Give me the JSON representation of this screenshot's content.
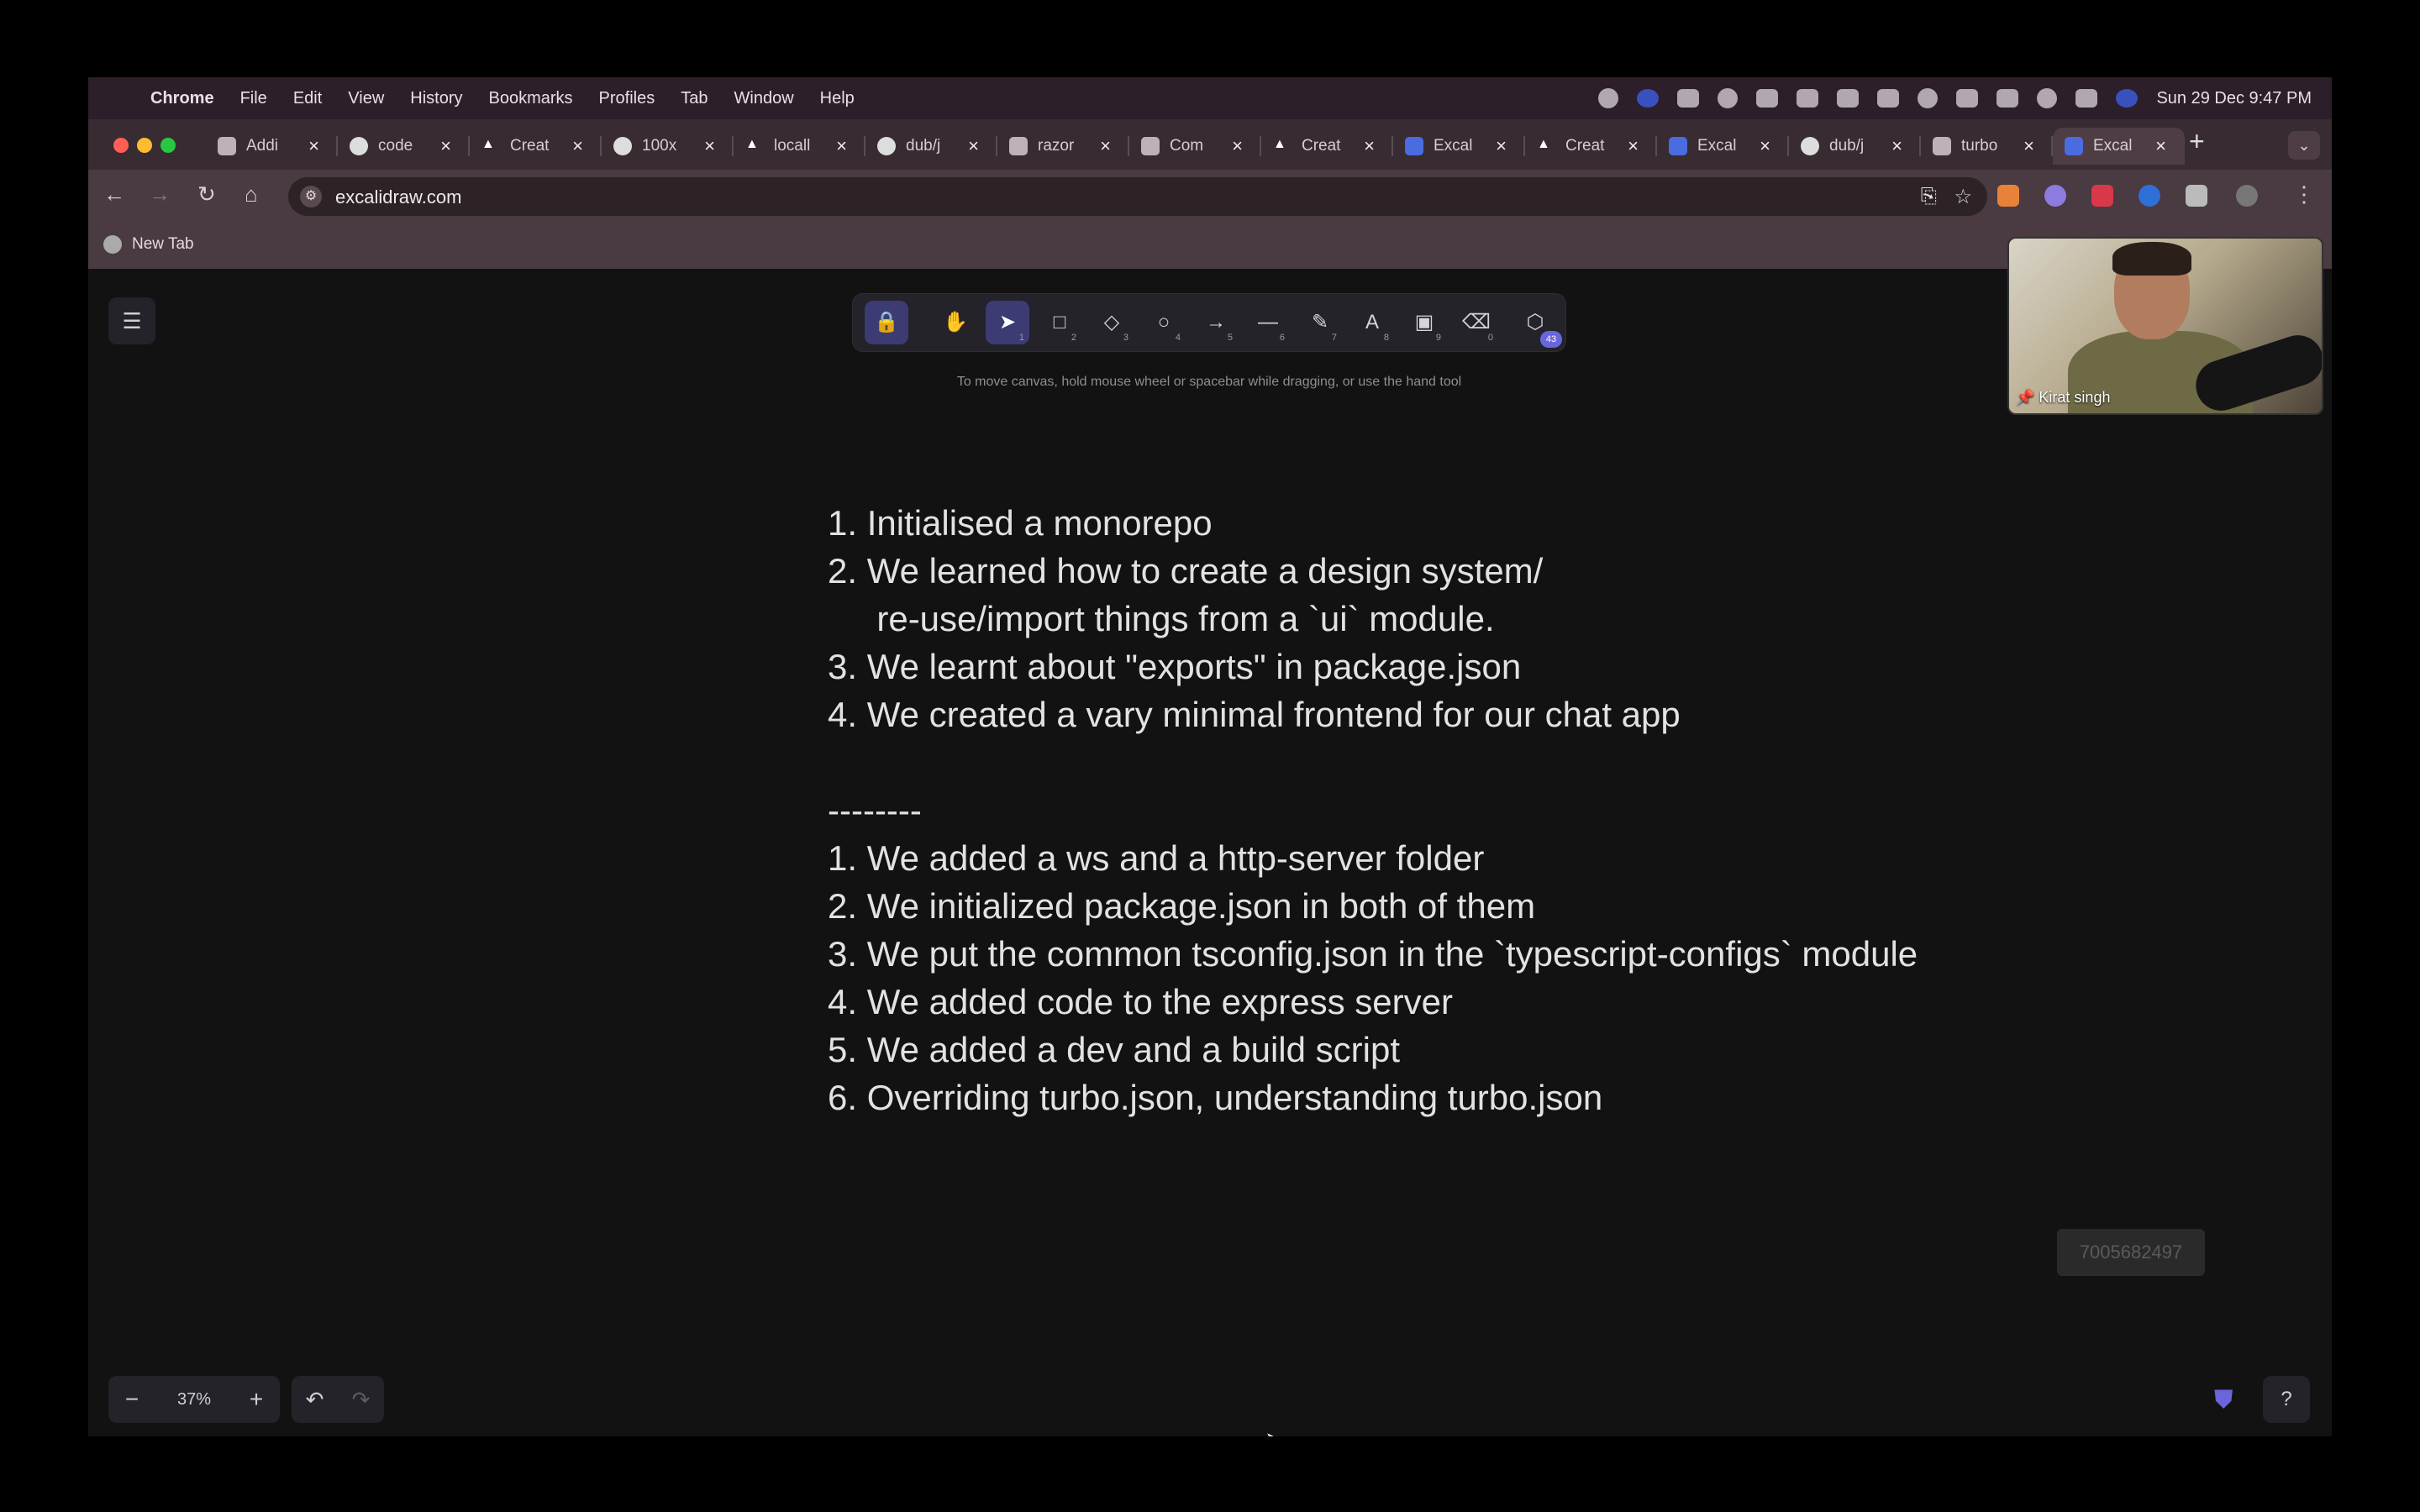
{
  "menubar": {
    "app": "Chrome",
    "items": [
      "File",
      "Edit",
      "View",
      "History",
      "Bookmarks",
      "Profiles",
      "Tab",
      "Window",
      "Help"
    ],
    "clock": "Sun 29 Dec  9:47 PM"
  },
  "tabs": [
    {
      "title": "Addi",
      "icon": "notion-icon",
      "active": false
    },
    {
      "title": "code",
      "icon": "github-icon",
      "active": false
    },
    {
      "title": "Creat",
      "icon": "vercel-icon",
      "active": false
    },
    {
      "title": "100x",
      "icon": "github-icon",
      "active": false
    },
    {
      "title": "locall",
      "icon": "vercel-icon",
      "active": false
    },
    {
      "title": "dub/j",
      "icon": "github-icon",
      "active": false
    },
    {
      "title": "razor",
      "icon": "google-icon",
      "active": false
    },
    {
      "title": "Com",
      "icon": "tab-icon",
      "active": false
    },
    {
      "title": "Creat",
      "icon": "vercel-icon",
      "active": false
    },
    {
      "title": "Excal",
      "icon": "excalidraw-icon",
      "active": false
    },
    {
      "title": "Creat",
      "icon": "vercel-icon",
      "active": false
    },
    {
      "title": "Excal",
      "icon": "excalidraw-icon",
      "active": false
    },
    {
      "title": "dub/j",
      "icon": "github-icon",
      "active": false
    },
    {
      "title": "turbo",
      "icon": "tab-icon",
      "active": false
    },
    {
      "title": "Excal",
      "icon": "excalidraw-icon",
      "active": true
    }
  ],
  "address_bar": {
    "url": "excalidraw.com"
  },
  "bookmarks": [
    {
      "label": "New Tab"
    }
  ],
  "excalidraw": {
    "tools": [
      {
        "name": "lock-tool",
        "glyph": "🔒",
        "key": ""
      },
      {
        "name": "hand-tool",
        "glyph": "✋",
        "key": ""
      },
      {
        "name": "selection-tool",
        "glyph": "➤",
        "key": "1"
      },
      {
        "name": "rectangle-tool",
        "glyph": "□",
        "key": "2"
      },
      {
        "name": "diamond-tool",
        "glyph": "◇",
        "key": "3"
      },
      {
        "name": "ellipse-tool",
        "glyph": "○",
        "key": "4"
      },
      {
        "name": "arrow-tool",
        "glyph": "→",
        "key": "5"
      },
      {
        "name": "line-tool",
        "glyph": "—",
        "key": "6"
      },
      {
        "name": "draw-tool",
        "glyph": "✎",
        "key": "7"
      },
      {
        "name": "text-tool",
        "glyph": "A",
        "key": "8"
      },
      {
        "name": "image-tool",
        "glyph": "▣",
        "key": "9"
      },
      {
        "name": "eraser-tool",
        "glyph": "⌫",
        "key": "0"
      },
      {
        "name": "library-tool",
        "glyph": "⬡",
        "key": ""
      }
    ],
    "library_badge": "43",
    "hint": "To move canvas, hold mouse wheel or spacebar while dragging, or use the hand tool",
    "notes": [
      "1. Initialised a monorepo",
      "2. We learned how to create a design system/",
      "     re-use/import things from a `ui` module.",
      "3. We learnt about \"exports\" in package.json",
      "4. We created a vary minimal frontend for our chat app",
      "",
      "--------",
      "1. We added a ws and a http-server folder",
      "2. We initialized package.json in both of them",
      "3. We put the common tsconfig.json in the `typescript-configs` module",
      "4. We added code to the express server",
      "5. We added a dev and a build script",
      "6. Overriding turbo.json, understanding turbo.json"
    ],
    "zoom": "37%",
    "phone_overlay": "7005682497"
  },
  "video": {
    "name": "Kirat singh"
  },
  "colors": {
    "accent": "#6965db",
    "canvas": "#121212",
    "browser_chrome": "#4a3a41"
  }
}
